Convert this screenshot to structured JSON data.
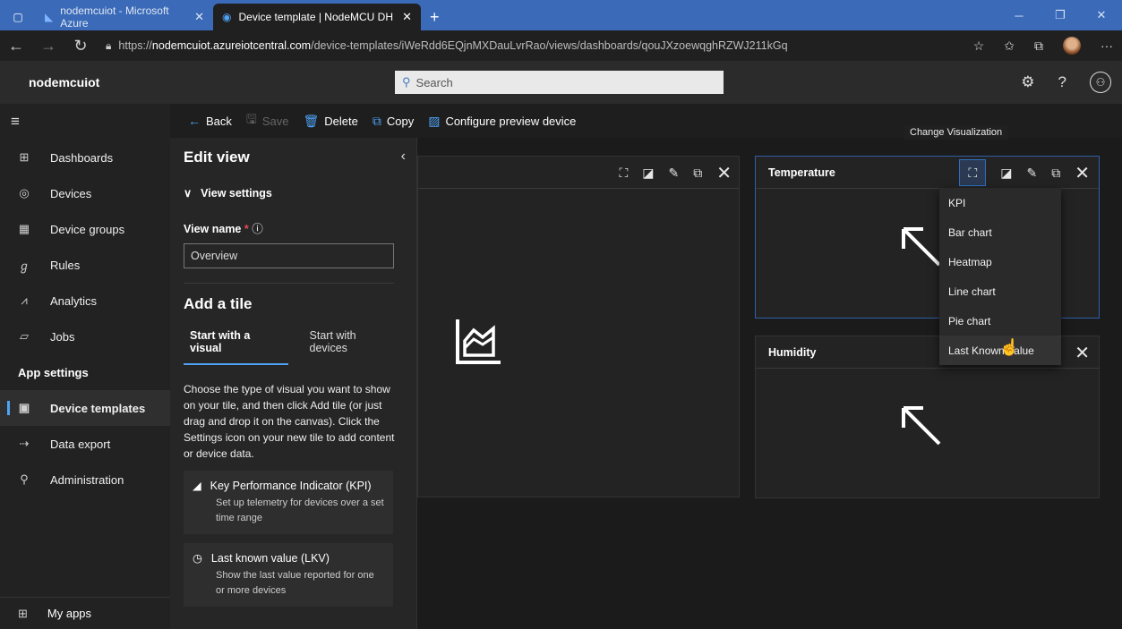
{
  "browser": {
    "tabs": [
      {
        "label": "nodemcuiot - Microsoft Azure",
        "active": false
      },
      {
        "label": "Device template | NodeMCU DH",
        "active": true
      }
    ],
    "url_prefix": "https://",
    "url_host": "nodemcuiot.azureiotcentral.com",
    "url_path": "/device-templates/iWeRdd6EQjnMXDauLvrRao/views/dashboards/qouJXzoewqghRZWJ211kGq"
  },
  "app": {
    "name": "nodemcuiot",
    "search_placeholder": "Search"
  },
  "sidebar": {
    "items": [
      {
        "label": "Dashboards",
        "icon": "dashboard-icon"
      },
      {
        "label": "Devices",
        "icon": "devices-icon"
      },
      {
        "label": "Device groups",
        "icon": "device-groups-icon"
      },
      {
        "label": "Rules",
        "icon": "rules-icon"
      },
      {
        "label": "Analytics",
        "icon": "analytics-icon"
      },
      {
        "label": "Jobs",
        "icon": "jobs-icon"
      }
    ],
    "section": "App settings",
    "settings_items": [
      {
        "label": "Device templates",
        "icon": "device-templates-icon",
        "selected": true
      },
      {
        "label": "Data export",
        "icon": "data-export-icon"
      },
      {
        "label": "Administration",
        "icon": "administration-icon"
      }
    ],
    "footer": "My apps"
  },
  "toolbar": {
    "back": "Back",
    "save": "Save",
    "delete": "Delete",
    "copy": "Copy",
    "configure": "Configure preview device"
  },
  "edit_view": {
    "title": "Edit view",
    "view_settings": "View settings",
    "view_name_label": "View name",
    "view_name_value": "Overview",
    "add_tile": "Add a tile",
    "tab_visual": "Start with a visual",
    "tab_devices": "Start with devices",
    "description": "Choose the type of visual you want to show on your tile, and then click Add tile (or just drag and drop it on the canvas). Click the Settings icon on your new tile to add content or device data.",
    "cards": [
      {
        "title": "Key Performance Indicator (KPI)",
        "sub": "Set up telemetry for devices over a set time range"
      },
      {
        "title": "Last known value (LKV)",
        "sub": "Show the last value reported for one or more devices"
      }
    ]
  },
  "tiles": {
    "temperature": "Temperature",
    "humidity": "Humidity"
  },
  "tooltip": "Change Visualization",
  "visualization_menu": [
    "KPI",
    "Bar chart",
    "Heatmap",
    "Line chart",
    "Pie chart",
    "Last Known Value"
  ]
}
